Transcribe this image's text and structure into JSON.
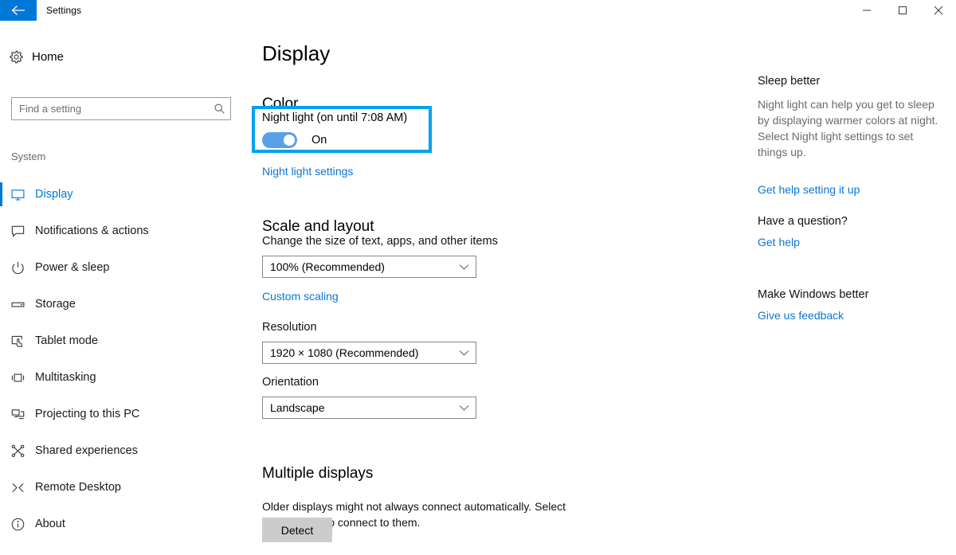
{
  "window": {
    "title": "Settings",
    "back_icon": "back-arrow-icon",
    "minimize_icon": "minimize-icon",
    "maximize_icon": "maximize-icon",
    "close_icon": "close-icon",
    "accent_color": "#0078d7"
  },
  "sidebar": {
    "home_label": "Home",
    "home_icon": "gear-icon",
    "search": {
      "placeholder": "Find a setting",
      "value": "",
      "icon": "search-icon"
    },
    "section_title": "System",
    "items": [
      {
        "label": "Display",
        "icon": "monitor-icon",
        "selected": true
      },
      {
        "label": "Notifications & actions",
        "icon": "speech-bubble-icon",
        "selected": false
      },
      {
        "label": "Power & sleep",
        "icon": "power-icon",
        "selected": false
      },
      {
        "label": "Storage",
        "icon": "drive-icon",
        "selected": false
      },
      {
        "label": "Tablet mode",
        "icon": "tablet-touch-icon",
        "selected": false
      },
      {
        "label": "Multitasking",
        "icon": "multitask-icon",
        "selected": false
      },
      {
        "label": "Projecting to this PC",
        "icon": "project-screens-icon",
        "selected": false
      },
      {
        "label": "Shared experiences",
        "icon": "share-nodes-icon",
        "selected": false
      },
      {
        "label": "Remote Desktop",
        "icon": "remote-desktop-icon",
        "selected": false
      },
      {
        "label": "About",
        "icon": "info-circle-icon",
        "selected": false
      }
    ]
  },
  "main": {
    "page_title": "Display",
    "color_section": {
      "heading": "Color",
      "night_light_label": "Night light (on until 7:08 AM)",
      "night_light_state": "On",
      "night_light_on": true,
      "settings_link": "Night light settings",
      "highlight_color": "#00a2ed",
      "toggle_color": "#5aa0e6"
    },
    "scale_section": {
      "heading": "Scale and layout",
      "scale_label": "Change the size of text, apps, and other items",
      "scale_value": "100% (Recommended)",
      "custom_scaling_link": "Custom scaling",
      "resolution_label": "Resolution",
      "resolution_value": "1920 × 1080 (Recommended)",
      "orientation_label": "Orientation",
      "orientation_value": "Landscape",
      "chevron_icon": "chevron-down-icon"
    },
    "multiple_displays": {
      "heading": "Multiple displays",
      "description": "Older displays might not always connect automatically. Select Detect to try to connect to them.",
      "detect_button": "Detect"
    }
  },
  "help": {
    "blocks": [
      {
        "heading": "Sleep better",
        "body": "Night light can help you get to sleep by displaying warmer colors at night. Select Night light settings to set things up.",
        "link": "Get help setting it up"
      },
      {
        "heading": "Have a question?",
        "link": "Get help"
      },
      {
        "heading": "Make Windows better",
        "link": "Give us feedback"
      }
    ],
    "link_color": "#0b76d0"
  }
}
